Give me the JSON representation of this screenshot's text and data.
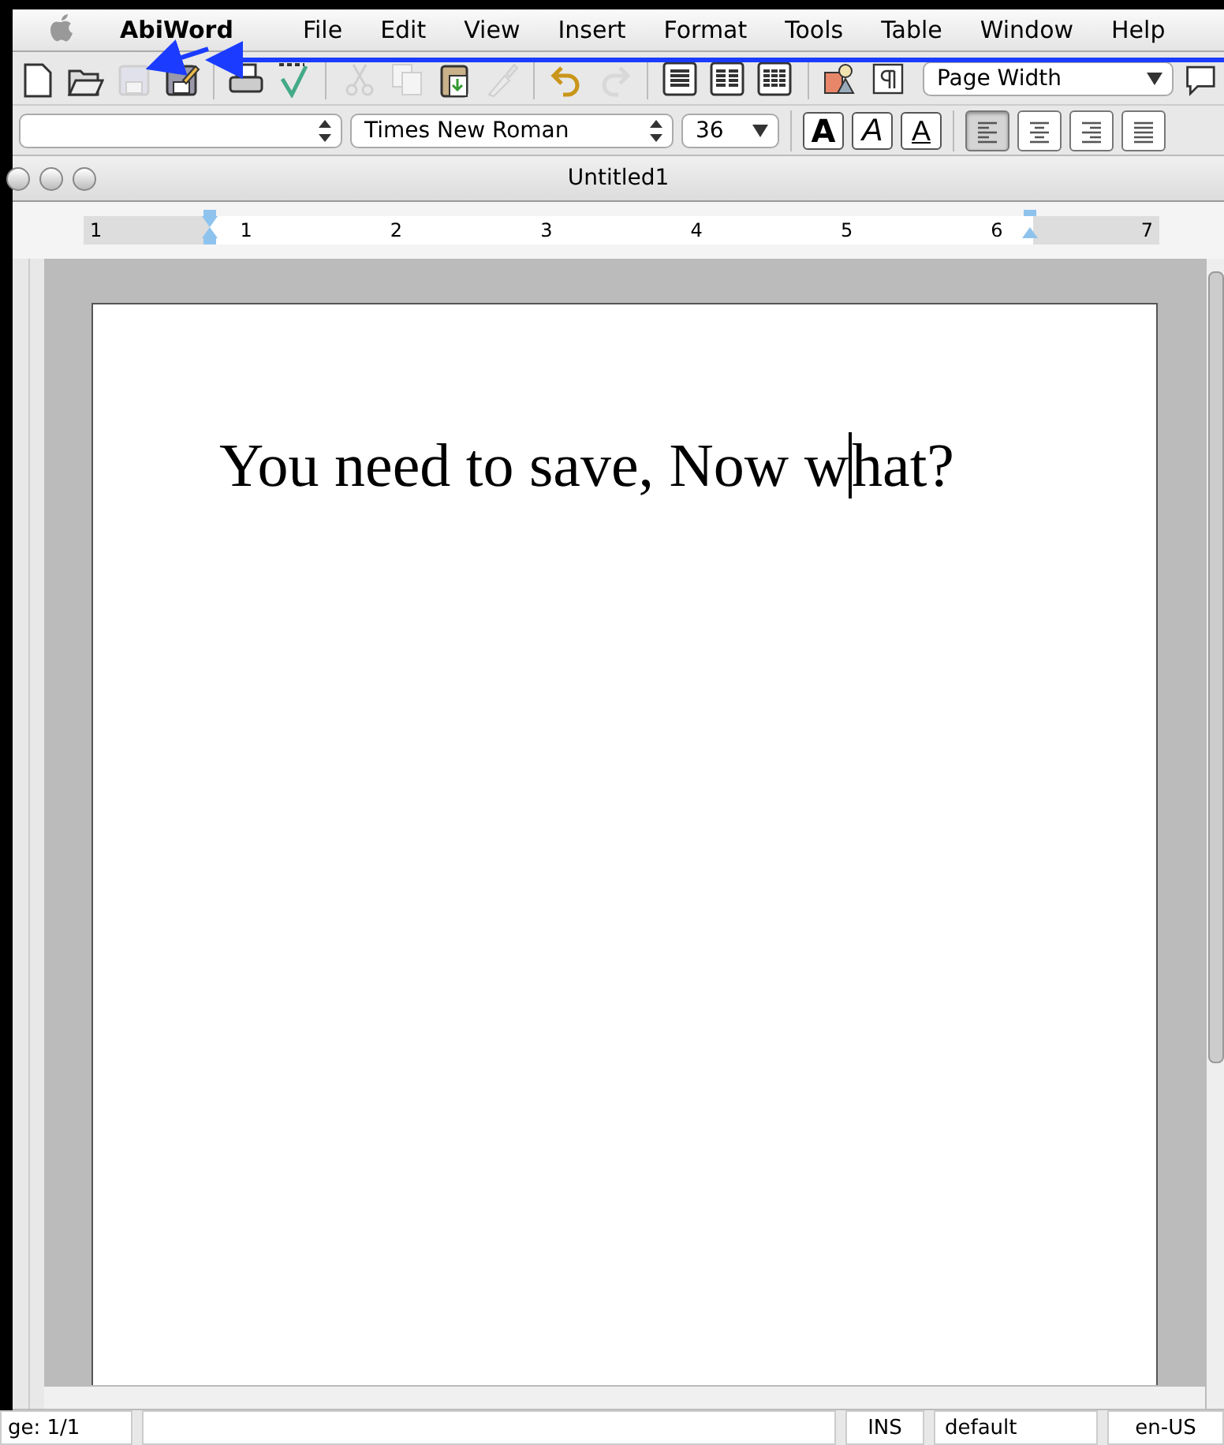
{
  "menu_bar": {
    "app_name": "AbiWord",
    "items": [
      "File",
      "Edit",
      "View",
      "Insert",
      "Format",
      "Tools",
      "Table",
      "Window",
      "Help"
    ]
  },
  "toolbar": {
    "buttons": [
      {
        "kind": "new",
        "disabled": false
      },
      {
        "kind": "open",
        "disabled": false
      },
      {
        "kind": "save",
        "disabled": true
      },
      {
        "kind": "saveas",
        "disabled": false
      },
      {
        "kind": "sep"
      },
      {
        "kind": "print",
        "disabled": false
      },
      {
        "kind": "spell",
        "disabled": false
      },
      {
        "kind": "sep"
      },
      {
        "kind": "cut",
        "disabled": true
      },
      {
        "kind": "copy",
        "disabled": true
      },
      {
        "kind": "paste",
        "disabled": false
      },
      {
        "kind": "brush",
        "disabled": true
      },
      {
        "kind": "sep"
      },
      {
        "kind": "undo",
        "disabled": false
      },
      {
        "kind": "redo",
        "disabled": true
      },
      {
        "kind": "sep"
      },
      {
        "kind": "col1",
        "disabled": false
      },
      {
        "kind": "col2",
        "disabled": false
      },
      {
        "kind": "col3",
        "disabled": false
      },
      {
        "kind": "sep"
      },
      {
        "kind": "image",
        "disabled": false
      },
      {
        "kind": "pilcrow",
        "disabled": false
      }
    ],
    "zoom": "Page Width"
  },
  "format_bar": {
    "font": "Times New Roman",
    "size": "36",
    "styles": [
      {
        "kind": "bold",
        "label": "A"
      },
      {
        "kind": "italic",
        "label": "A"
      },
      {
        "kind": "underline",
        "label": "A"
      }
    ],
    "alignments": [
      {
        "kind": "left",
        "selected": true
      },
      {
        "kind": "center",
        "selected": false
      },
      {
        "kind": "right",
        "selected": false
      },
      {
        "kind": "justify",
        "selected": false
      }
    ]
  },
  "window": {
    "title": "Untitled1"
  },
  "ruler": {
    "labels": [
      "1",
      "1",
      "2",
      "3",
      "4",
      "5",
      "6",
      "7"
    ]
  },
  "document": {
    "text_before_cursor": "You need to save, Now w",
    "text_after_cursor": "hat?"
  },
  "status_bar": {
    "page": "ge: 1/1",
    "mode": "INS",
    "style": "default",
    "language": "en-US"
  }
}
